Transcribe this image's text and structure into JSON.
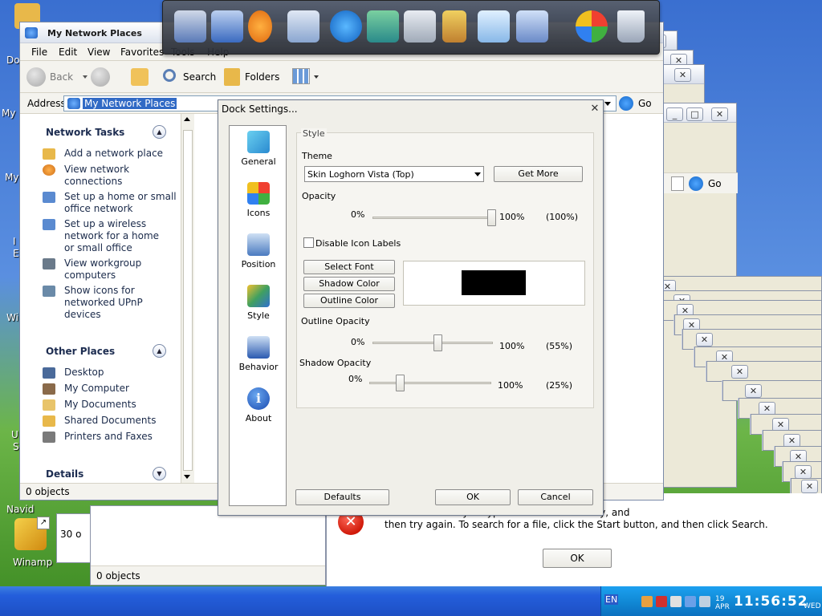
{
  "desktop": {
    "icons": [
      {
        "label": "Do"
      },
      {
        "label": "My"
      },
      {
        "label": "My"
      },
      {
        "label": "I"
      },
      {
        "label": "E"
      },
      {
        "label": "Wi"
      },
      {
        "label": "U"
      },
      {
        "label": "S"
      },
      {
        "label": "Navid"
      },
      {
        "label": "Winamp"
      }
    ]
  },
  "explorer": {
    "title": "My Network Places",
    "menu": [
      "File",
      "Edit",
      "View",
      "Favorites",
      "Tools",
      "Help"
    ],
    "toolbar": {
      "back": "Back",
      "search": "Search",
      "folders": "Folders"
    },
    "address_label": "Address",
    "address_value": "My Network Places",
    "go_label": "Go",
    "network_tasks": {
      "header": "Network Tasks",
      "items": [
        "Add a network place",
        "View network connections",
        "Set up a home or small office network",
        "Set up a wireless network for a home or small office",
        "View workgroup computers",
        "Show icons for networked UPnP devices"
      ]
    },
    "other_places": {
      "header": "Other Places",
      "items": [
        "Desktop",
        "My Computer",
        "My Documents",
        "Shared Documents",
        "Printers and Faxes"
      ]
    },
    "details_header": "Details",
    "status": "0 objects"
  },
  "background_windows": {
    "go_label": "Go",
    "status_1": "30 o",
    "status_2": "0 objects"
  },
  "dock": {
    "icons": [
      "monitor-icon",
      "network-icon",
      "media-player-icon",
      "documents-icon",
      "internet-explorer-icon",
      "display-icon",
      "calculator-icon",
      "pencil-cup-icon",
      "notepad-icon",
      "control-panel-icon",
      "windows-update-icon",
      "recycle-bin-icon"
    ]
  },
  "dock_settings": {
    "title": "Dock Settings...",
    "nav": [
      "General",
      "Icons",
      "Position",
      "Style",
      "Behavior",
      "About"
    ],
    "group_label": "Style",
    "theme_label": "Theme",
    "theme_value": "Skin Loghorn Vista (Top)",
    "get_more": "Get More",
    "opacity": {
      "label": "Opacity",
      "min": "0%",
      "max": "100%",
      "value_text": "(100%)",
      "value": 100
    },
    "disable_labels": "Disable Icon Labels",
    "disable_labels_checked": false,
    "select_font": "Select Font",
    "shadow_color": "Shadow Color",
    "outline_color": "Outline Color",
    "outline_opacity": {
      "label": "Outline Opacity",
      "min": "0%",
      "max": "100%",
      "value_text": "(55%)",
      "value": 55
    },
    "shadow_opacity": {
      "label": "Shadow Opacity",
      "min": "0%",
      "max": "100%",
      "value_text": "(25%)",
      "value": 25
    },
    "defaults": "Defaults",
    "ok": "OK",
    "cancel": "Cancel"
  },
  "error_dialog": {
    "message_line1": "exe'. Make sure you typed the name correctly, and",
    "message_line2": "then try again. To search for a file, click the Start button, and then click Search.",
    "ok": "OK"
  },
  "taskbar": {
    "lang": "EN",
    "clock_time": "11:56:52",
    "clock_day": "19",
    "clock_month": "APR",
    "clock_weekday": "WED"
  }
}
